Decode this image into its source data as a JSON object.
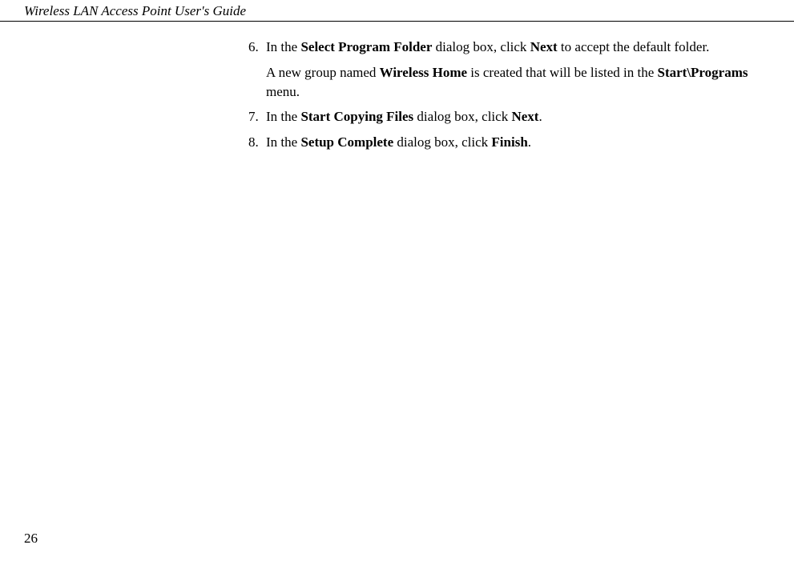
{
  "header_title": "Wireless LAN Access Point User's Guide",
  "item6": {
    "number": "6.",
    "text_pre": "In the ",
    "bold1": "Select Program Folder",
    "text_mid1": " dialog box, click ",
    "bold2": "Next",
    "text_end": " to accept the default folder.",
    "sub_pre": "A new group named ",
    "sub_bold1": "Wireless Home",
    "sub_mid": " is created that will be listed in the ",
    "sub_bold2": "Start\\Programs",
    "sub_end": " menu."
  },
  "item7": {
    "number": "7.",
    "text_pre": "In the ",
    "bold1": "Start Copying Files",
    "text_mid": " dialog box, click ",
    "bold2": "Next",
    "text_end": "."
  },
  "item8": {
    "number": "8.",
    "text_pre": "In the ",
    "bold1": "Setup Complete",
    "text_mid": " dialog box, click ",
    "bold2": "Finish",
    "text_end": "."
  },
  "page_number": "26"
}
